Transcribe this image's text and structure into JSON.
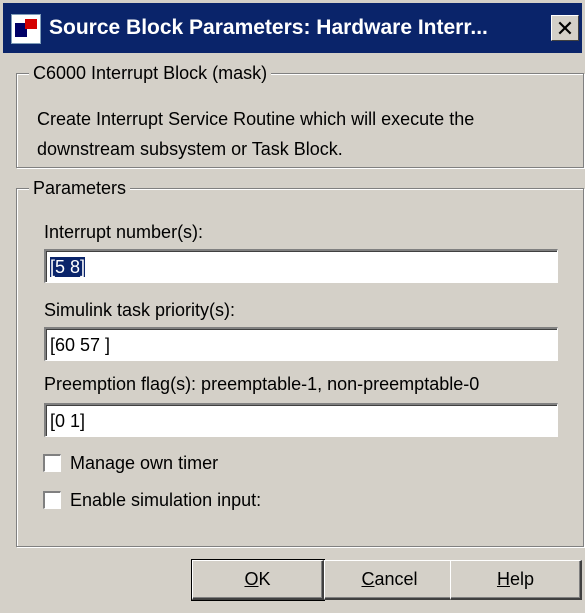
{
  "window": {
    "title": "Source Block Parameters: Hardware Interr...",
    "close_glyph": "✕"
  },
  "mask_group": {
    "legend": "C6000 Interrupt Block (mask)",
    "description": "Create Interrupt Service Routine which will execute the downstream subsystem or Task Block."
  },
  "params_group": {
    "legend": "Parameters",
    "fields": [
      {
        "label": "Interrupt number(s):",
        "value": "[5 8]"
      },
      {
        "label": "Simulink task priority(s):",
        "value": "[60 57 ]"
      },
      {
        "label": "Preemption flag(s): preemptable-1, non-preemptable-0",
        "value": "[0 1]"
      }
    ],
    "checkboxes": [
      {
        "label": "Manage own timer",
        "checked": false
      },
      {
        "label": "Enable simulation input:",
        "checked": false
      }
    ]
  },
  "buttons": {
    "ok": {
      "mnemonic": "O",
      "rest": "K"
    },
    "cancel": {
      "mnemonic": "C",
      "rest": "ancel"
    },
    "help": {
      "mnemonic": "H",
      "rest": "elp"
    }
  },
  "icons": {
    "app": "simulink-block-icon",
    "close": "close-icon"
  }
}
